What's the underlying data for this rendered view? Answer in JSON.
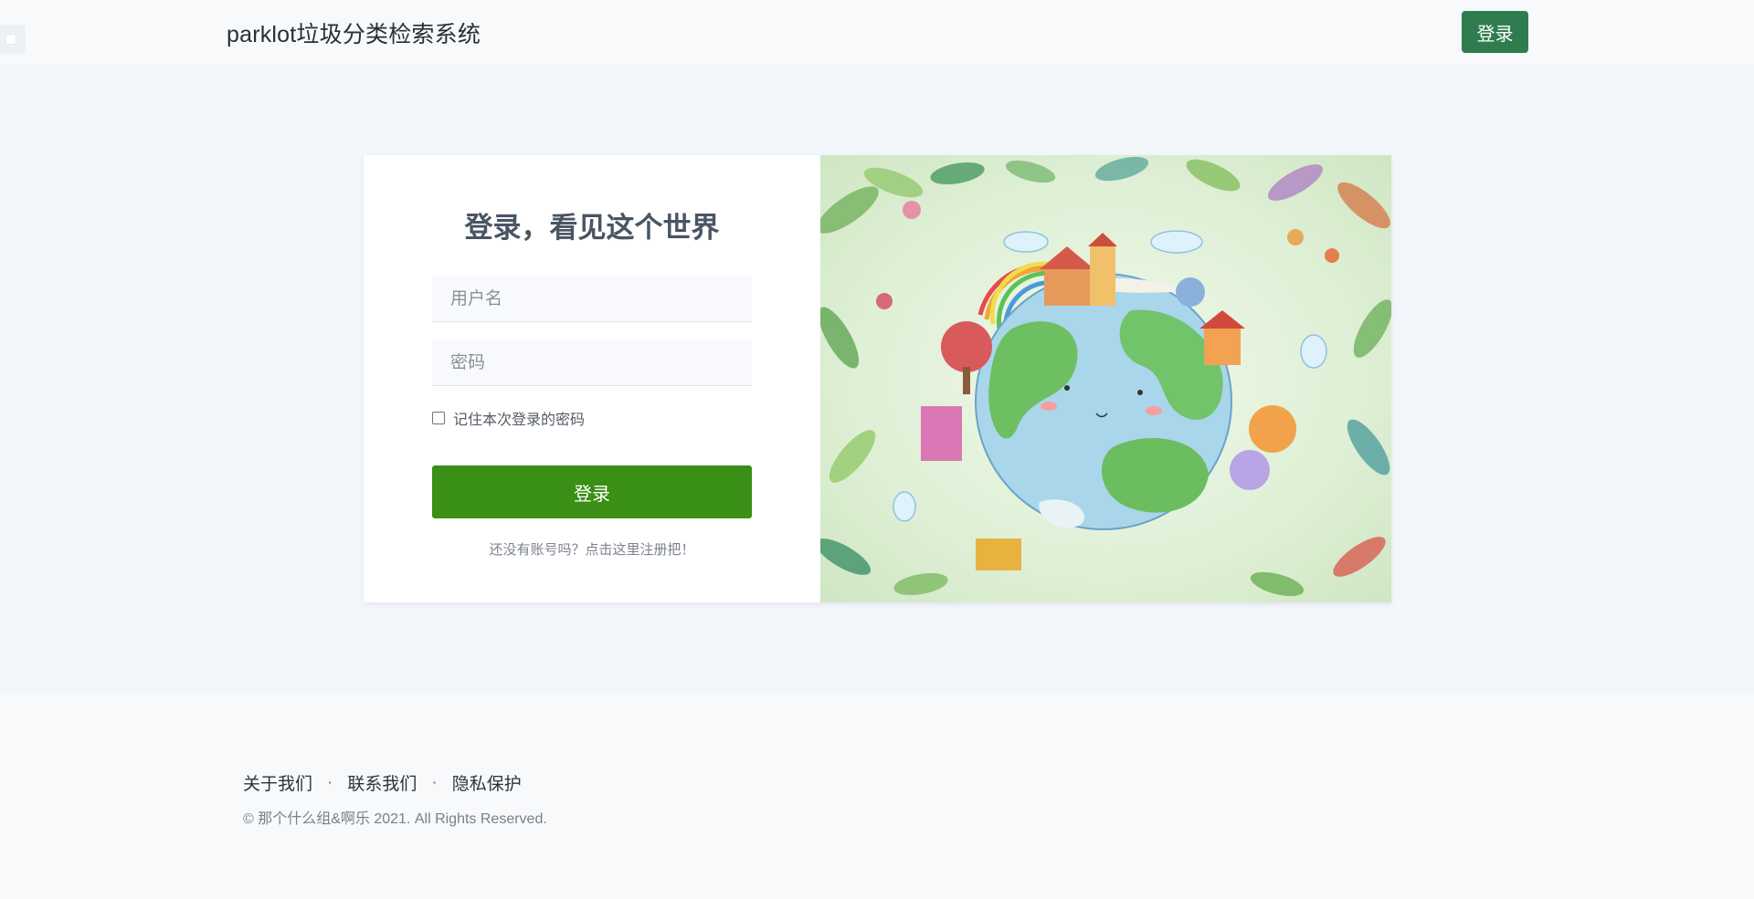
{
  "navbar": {
    "brand": "parklot垃圾分类检索系统",
    "login_label": "登录"
  },
  "login_form": {
    "title": "登录，看见这个世界",
    "username_placeholder": "用户名",
    "password_placeholder": "密码",
    "remember_label": "记住本次登录的密码",
    "submit_label": "登录",
    "register_link": "还没有账号吗？点击这里注册把！"
  },
  "footer": {
    "links": [
      "关于我们",
      "联系我们",
      "隐私保护"
    ],
    "separator": "·",
    "copyright": "© 那个什么组&啊乐 2021. All Rights Reserved."
  },
  "colors": {
    "nav_button": "#2f7d4f",
    "submit_button": "#3a8f16",
    "page_background": "#f3f7fc"
  },
  "icons": {
    "sidebar_toggle": "square-icon",
    "remember_checkbox": "checkbox-icon"
  }
}
